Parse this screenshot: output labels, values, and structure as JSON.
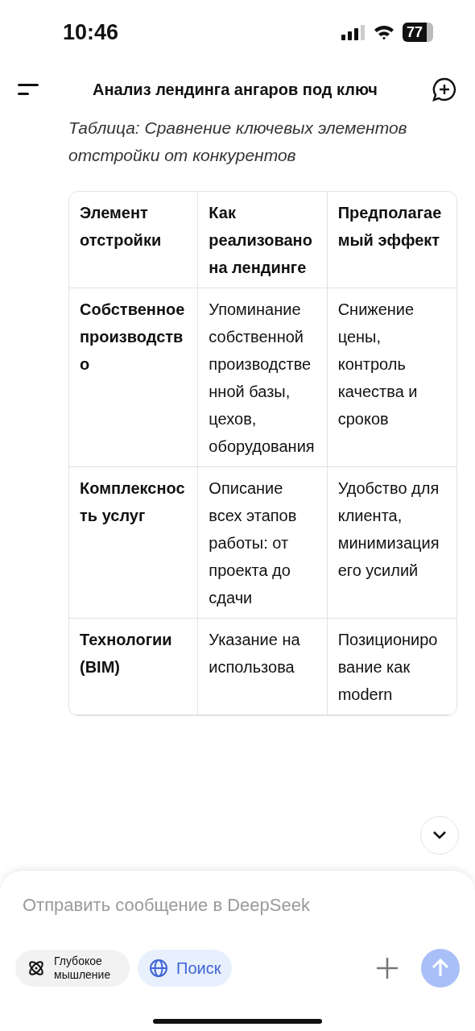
{
  "status_bar": {
    "time": "10:46",
    "battery": "77"
  },
  "header": {
    "title": "Анализ лендинга ангаров под ключ"
  },
  "caption": "Таблица: Сравнение ключевых элементов отстройки от конкурентов",
  "table": {
    "columns": [
      "Элемент отстройки",
      "Как реализовано на лендинге",
      "Предполагаемый эффект"
    ],
    "rows": [
      [
        "Собственное производство",
        "Упоминание собственной производственной базы, цехов, оборудования",
        "Снижение цены, контроль качества и сроков"
      ],
      [
        "Комплексность услуг",
        "Описание всех этапов работы: от проекта до сдачи",
        "Удобство для клиента, минимизация его усилий"
      ],
      [
        "Технологии (BIM)",
        "Указание на использова",
        "Позиционирование как modern"
      ]
    ]
  },
  "composer": {
    "placeholder": "Отправить сообщение в DeepSeek",
    "toggles": [
      {
        "kind": "think",
        "label": "Глубокое мышление",
        "selected": false
      },
      {
        "kind": "search",
        "label": "Поиск",
        "selected": true
      }
    ],
    "send": {
      "disabled": true
    }
  }
}
